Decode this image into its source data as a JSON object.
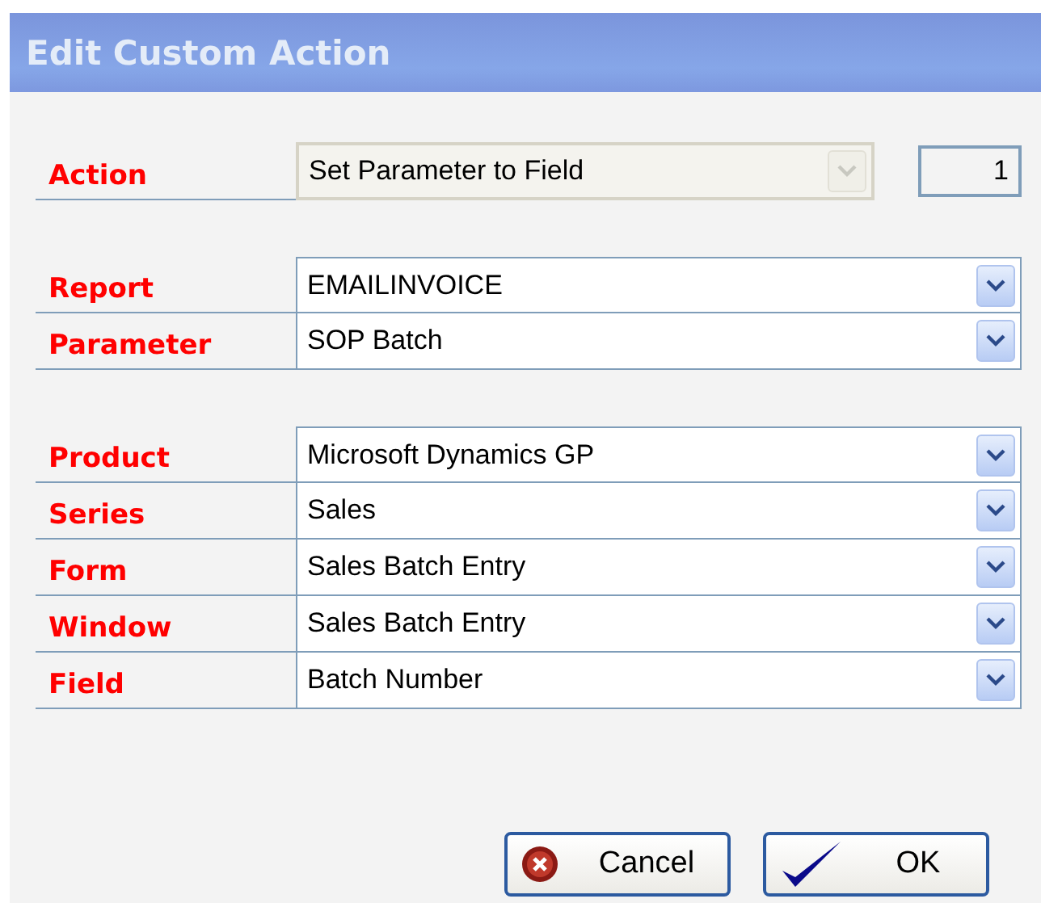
{
  "window": {
    "title": "Edit Custom Action"
  },
  "action": {
    "label": "Action",
    "value": "Set Parameter to Field",
    "disabled": true,
    "number": "1"
  },
  "groups": [
    {
      "rows": [
        {
          "label": "Report",
          "value": "EMAILINVOICE"
        },
        {
          "label": "Parameter",
          "value": "SOP Batch"
        }
      ]
    },
    {
      "rows": [
        {
          "label": "Product",
          "value": "Microsoft Dynamics GP"
        },
        {
          "label": "Series",
          "value": "Sales"
        },
        {
          "label": "Form",
          "value": "Sales Batch Entry"
        },
        {
          "label": "Window",
          "value": "Sales Batch Entry"
        },
        {
          "label": "Field",
          "value": "Batch Number"
        }
      ]
    }
  ],
  "buttons": [
    {
      "label": "Cancel",
      "kind": "cancel"
    },
    {
      "label": "OK",
      "kind": "ok"
    }
  ]
}
